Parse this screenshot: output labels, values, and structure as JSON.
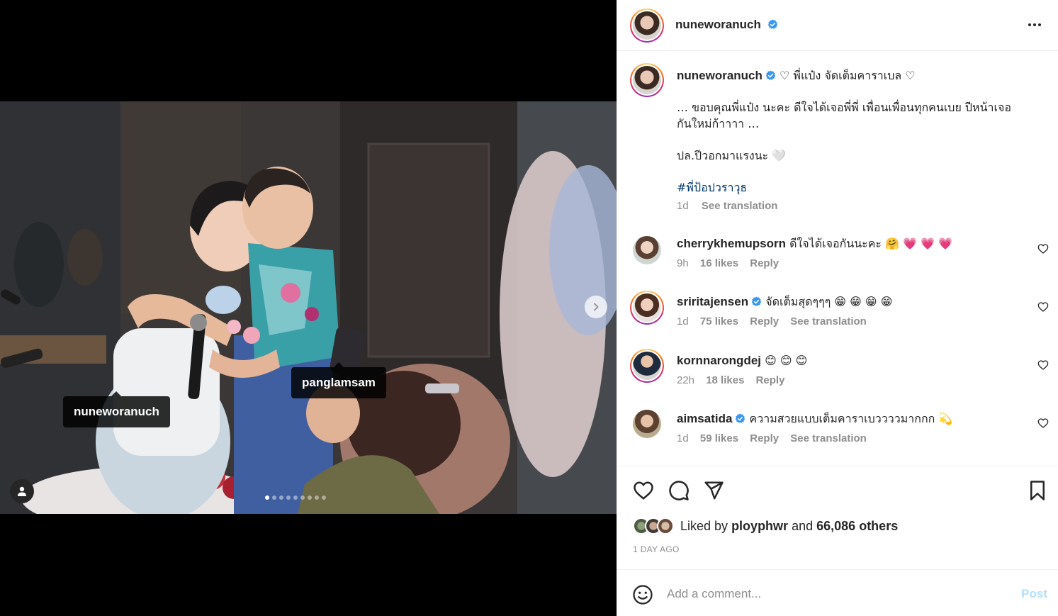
{
  "colors": {
    "verified": "#3897f0",
    "link": "#00376b",
    "muted": "#8e8e8e",
    "post_disabled": "#b2dffc"
  },
  "media": {
    "tags": [
      "nuneworanuch",
      "panglamsam"
    ],
    "carousel": {
      "count": 9,
      "active_index": 0
    },
    "icons": {
      "next": "chevron-right-icon",
      "user_tags": "person-icon"
    }
  },
  "header": {
    "username": "nuneworanuch",
    "verified": true,
    "more_icon": "more-horizontal-icon"
  },
  "caption": {
    "username": "nuneworanuch",
    "title": "♡ พี่แป๋ง จัดเต็มคาราเบล ♡",
    "line1": "… ขอบคุณพี่แป๋ง นะคะ ดีใจได้เจอพี่พี่ เพื่อนเพื่อนทุกคนเบย ปีหน้าเจอ",
    "line2": "กันใหม่ก้าาาา …",
    "line3": "ปล.ปีวอกมาแรงนะ 🤍",
    "hashtag": "#พี่ป้อปวราวุธ",
    "time": "1d",
    "see_translation": "See translation"
  },
  "comments": [
    {
      "username": "cherrykhemupsorn",
      "verified": false,
      "text": "ดีใจได้เจอกันนะคะ 🤗 💗 💗 💗",
      "time": "9h",
      "likes": "16 likes",
      "reply": "Reply",
      "see_translation": ""
    },
    {
      "username": "sriritajensen",
      "verified": true,
      "text": "จัดเต็มสุดๆๆๆ 😁 😁 😁 😁",
      "time": "1d",
      "likes": "75 likes",
      "reply": "Reply",
      "see_translation": "See translation"
    },
    {
      "username": "kornnarongdej",
      "verified": false,
      "text": "😊 😊 😊",
      "time": "22h",
      "likes": "18 likes",
      "reply": "Reply",
      "see_translation": ""
    },
    {
      "username": "aimsatida",
      "verified": true,
      "text": "ความสวยแบบเต็มคาราเบววววมากกก 💫",
      "time": "1d",
      "likes": "59 likes",
      "reply": "Reply",
      "see_translation": "See translation"
    }
  ],
  "actions": {
    "icons": [
      "heart-icon",
      "comment-icon",
      "share-icon",
      "bookmark-icon"
    ],
    "liked_prefix": "Liked by",
    "liked_user": "ployphwr",
    "liked_and": "and",
    "liked_others": "66,086 others",
    "time_ago": "1 DAY AGO"
  },
  "add_comment": {
    "placeholder": "Add a comment...",
    "post_label": "Post",
    "emoji_icon": "emoji-icon"
  }
}
